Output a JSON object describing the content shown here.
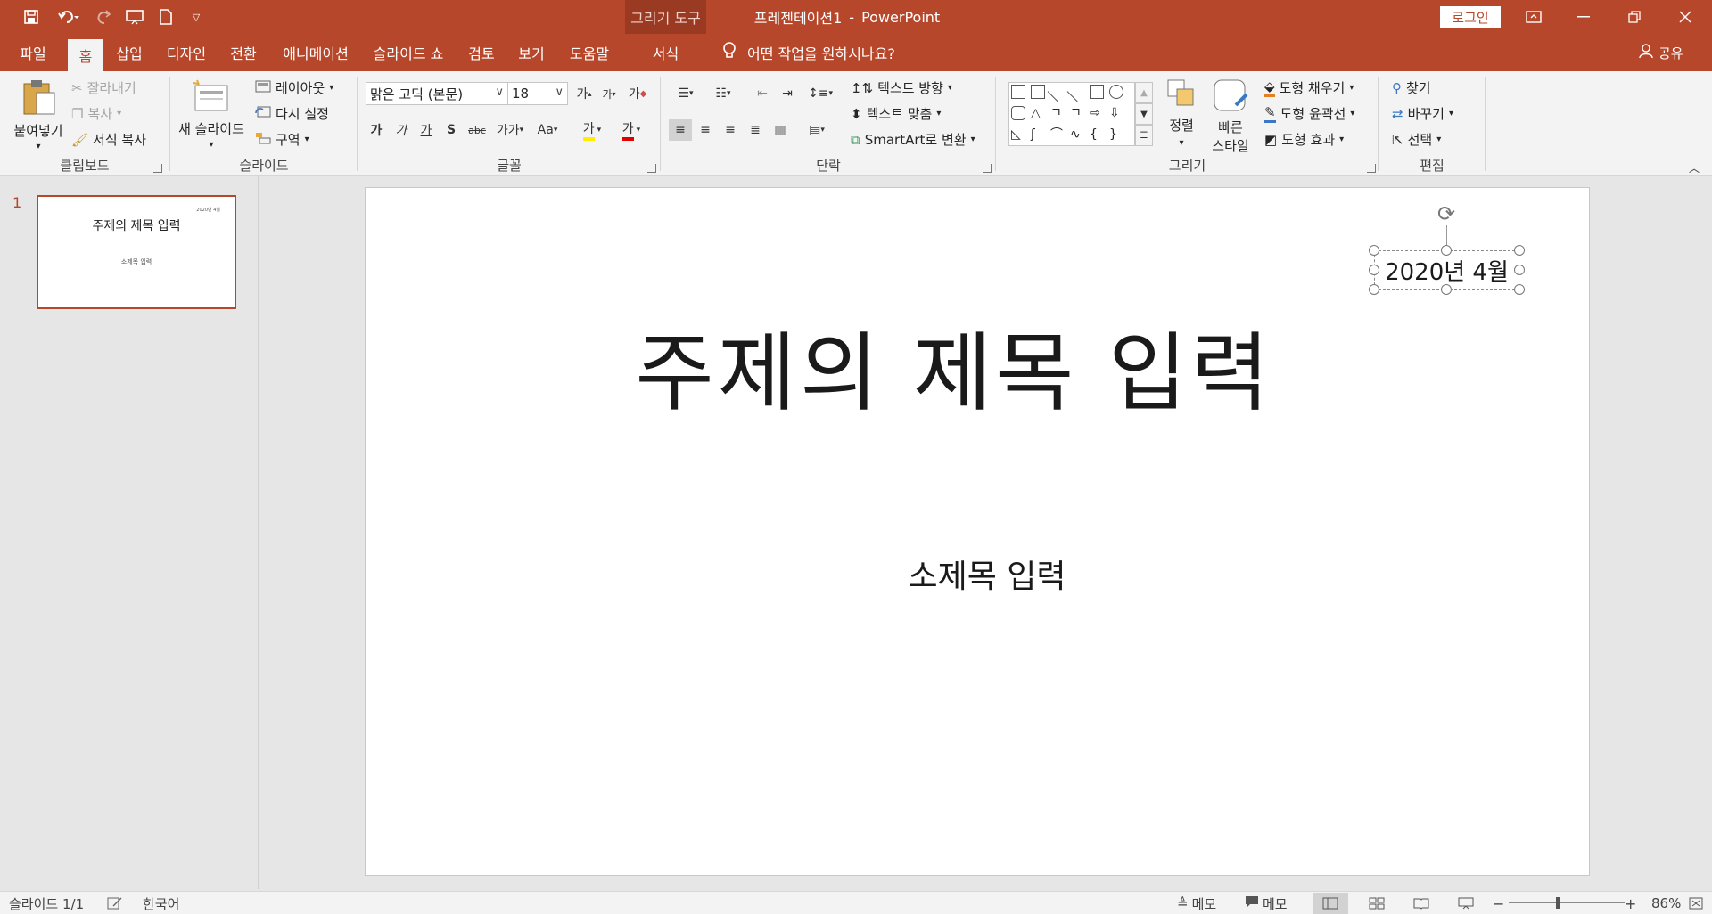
{
  "app": {
    "document_name": "프레젠테이션1",
    "separator": "-",
    "app_name": "PowerPoint",
    "context_tool": "그리기 도구",
    "login": "로그인"
  },
  "quick_access": {
    "icons": [
      "save-icon",
      "undo-icon",
      "redo-icon",
      "slideshow-icon",
      "new-file-icon",
      "customize-icon"
    ]
  },
  "tabs": [
    "파일",
    "홈",
    "삽입",
    "디자인",
    "전환",
    "애니메이션",
    "슬라이드 쇼",
    "검토",
    "보기",
    "도움말",
    "서식"
  ],
  "tell_me": "어떤 작업을 원하시나요?",
  "share": "공유",
  "ribbon": {
    "clipboard": {
      "label": "클립보드",
      "paste": "붙여넣기",
      "cut": "잘라내기",
      "copy": "복사",
      "format_painter": "서식 복사"
    },
    "slides": {
      "label": "슬라이드",
      "new_slide": "새 슬라이드",
      "layout": "레이아웃",
      "reset": "다시 설정",
      "section": "구역"
    },
    "font": {
      "label": "글꼴",
      "font_name": "맑은 고딕 (본문)",
      "font_size": "18",
      "grow": "가",
      "shrink": "가",
      "clear": "가",
      "bold": "가",
      "italic": "가",
      "underline": "가",
      "shadow": "S",
      "strike": "abc",
      "spacing": "가가",
      "case": "Aa",
      "highlight": "가",
      "color": "가"
    },
    "paragraph": {
      "label": "단락",
      "text_direction": "텍스트 방향",
      "align_text": "텍스트 맞춤",
      "smartart": "SmartArt로 변환"
    },
    "drawing": {
      "label": "그리기",
      "arrange": "정렬",
      "quick_styles_1": "빠른",
      "quick_styles_2": "스타일",
      "fill": "도형 채우기",
      "outline": "도형 윤곽선",
      "effects": "도형 효과"
    },
    "editing": {
      "label": "편집",
      "find": "찾기",
      "replace": "바꾸기",
      "select": "선택"
    }
  },
  "thumbnail": {
    "number": "1",
    "title": "주제의 제목 입력",
    "subtitle": "소제목 입력",
    "date": "2020년 4월"
  },
  "slide": {
    "title": "주제의 제목 입력",
    "subtitle": "소제목 입력",
    "date_text": "2020년 4월"
  },
  "status": {
    "slide_info": "슬라이드 1/1",
    "language": "한국어",
    "notes": "메모",
    "comments": "메모",
    "zoom": "86%"
  },
  "colors": {
    "accent": "#b7472a",
    "ribbon_bg": "#f3f3f3",
    "canvas_bg": "#e6e6e6"
  }
}
